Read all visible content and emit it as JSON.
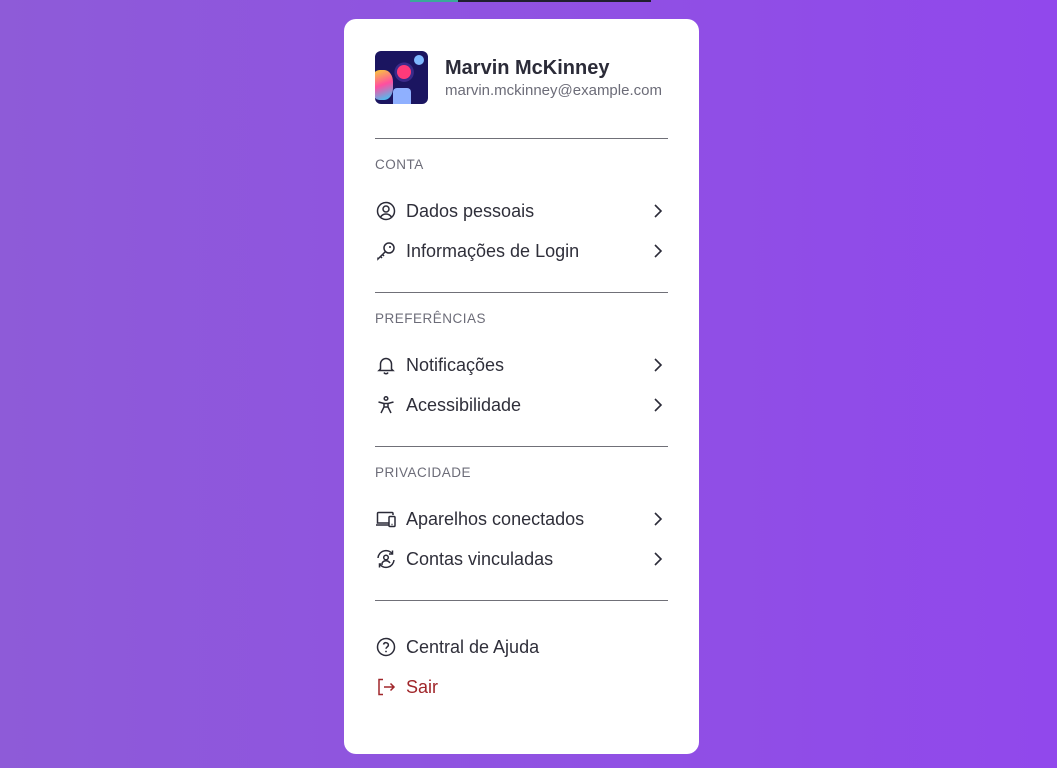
{
  "profile": {
    "name": "Marvin McKinney",
    "email": "marvin.mckinney@example.com"
  },
  "sections": [
    {
      "title": "CONTA",
      "items": [
        {
          "label": "Dados pessoais",
          "icon": "user-circle-icon"
        },
        {
          "label": "Informações de Login",
          "icon": "key-icon"
        }
      ]
    },
    {
      "title": "PREFERÊNCIAS",
      "items": [
        {
          "label": "Notificações",
          "icon": "bell-icon"
        },
        {
          "label": "Acessibilidade",
          "icon": "accessibility-icon"
        }
      ]
    },
    {
      "title": "PRIVACIDADE",
      "items": [
        {
          "label": "Aparelhos conectados",
          "icon": "devices-icon"
        },
        {
          "label": "Contas vinculadas",
          "icon": "linked-accounts-icon"
        }
      ]
    }
  ],
  "footer": {
    "help_label": "Central de Ajuda",
    "logout_label": "Sair"
  },
  "colors": {
    "background_start": "#8e5bd8",
    "background_end": "#9148ec",
    "logout": "#a0262a"
  }
}
